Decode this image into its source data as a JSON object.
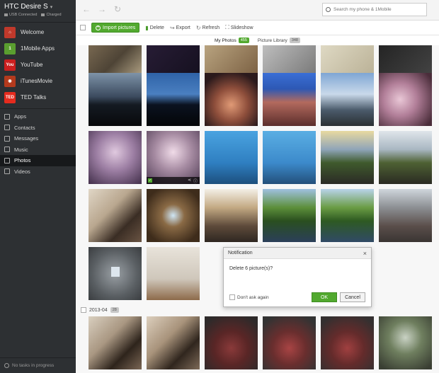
{
  "device": {
    "name": "HTC Desire S",
    "usb_status": "USB Connected",
    "battery_status": "Charged"
  },
  "sidebar": {
    "apps": [
      {
        "label": "Welcome",
        "icon": "home-icon",
        "color": "#c0392b",
        "glyph": "⌂"
      },
      {
        "label": "1Mobile Apps",
        "icon": "1mobile-icon",
        "color": "#5a9e2f",
        "glyph": "1"
      },
      {
        "label": "YouTube",
        "icon": "youtube-icon",
        "color": "#cc1f1f",
        "glyph": "You"
      },
      {
        "label": "iTunesMovie",
        "icon": "itunes-icon",
        "color": "#b33a1d",
        "glyph": "◉"
      },
      {
        "label": "TED Talks",
        "icon": "ted-icon",
        "color": "#e62b1e",
        "glyph": "TED"
      }
    ],
    "nav": [
      {
        "label": "Apps",
        "icon": "apps-icon",
        "active": false
      },
      {
        "label": "Contacts",
        "icon": "contacts-icon",
        "active": false
      },
      {
        "label": "Messages",
        "icon": "messages-icon",
        "active": false
      },
      {
        "label": "Music",
        "icon": "music-icon",
        "active": false
      },
      {
        "label": "Photos",
        "icon": "photos-icon",
        "active": true
      },
      {
        "label": "Videos",
        "icon": "videos-icon",
        "active": false
      }
    ],
    "task_status": "No tasks in progress"
  },
  "topbar": {
    "search_placeholder": "Search my phone & 1Mobile"
  },
  "toolbar": {
    "import_label": "Import pictures",
    "delete_label": "Delete",
    "export_label": "Export",
    "refresh_label": "Refresh",
    "slideshow_label": "Slideshow"
  },
  "tabs": [
    {
      "label": "My Photos",
      "count": "455",
      "active": true
    },
    {
      "label": "Picture Library",
      "count": "348",
      "active": false
    }
  ],
  "date_group": {
    "label": "2013-04",
    "count": "28"
  },
  "dialog": {
    "title": "Notification",
    "message": "Delete 6 picture(s)?",
    "dont_ask_label": "Don't ask again",
    "ok_label": "OK",
    "cancel_label": "Cancel"
  },
  "colors": {
    "accent": "#52a92f",
    "sidebar_bg": "#2d3033"
  }
}
